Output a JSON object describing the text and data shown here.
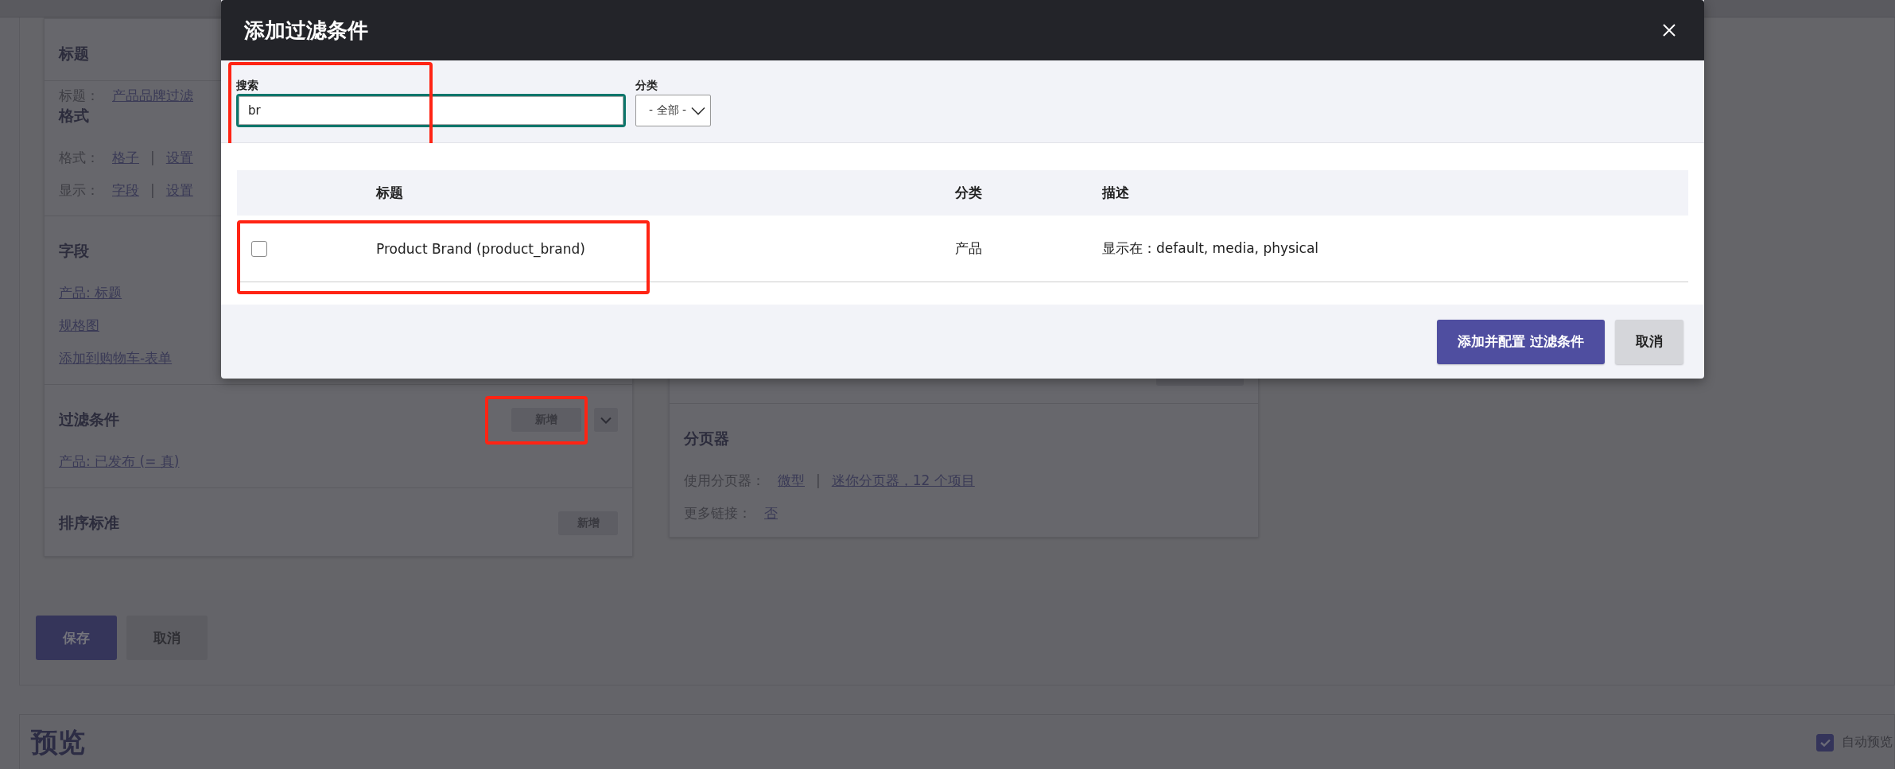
{
  "left_card": {
    "sections": [
      {
        "kind": "fields",
        "heading": "标题",
        "rows": [
          {
            "label": "标题：",
            "values": [
              "产品品牌过滤"
            ]
          }
        ]
      },
      {
        "kind": "fields",
        "heading": "格式",
        "rows": [
          {
            "label": "格式：",
            "values": [
              "格子",
              "设置"
            ],
            "separator": "|"
          },
          {
            "label": "显示：",
            "values": [
              "字段",
              "设置"
            ],
            "separator": "|"
          }
        ]
      },
      {
        "kind": "links",
        "heading": "字段",
        "links": [
          "产品: 标题",
          "规格图",
          "添加到购物车-表单"
        ]
      },
      {
        "kind": "links",
        "heading": "过滤条件",
        "add_button": {
          "label": "新增",
          "highlighted": true,
          "dropdown": true
        },
        "links": [
          "产品: 已发布 (= 真)"
        ]
      },
      {
        "kind": "links",
        "heading": "排序标准",
        "add_button": {
          "label": "新增",
          "highlighted": false,
          "dropdown": false
        }
      }
    ]
  },
  "middle_card": {
    "sections": [
      {
        "kind": "fields",
        "heading": "分页器",
        "rows": [
          {
            "label": "使用分页器：",
            "values": [
              "微型",
              "迷你分页器，12 个项目"
            ],
            "separator": "|"
          },
          {
            "label": "更多链接：",
            "values": [
              "否"
            ]
          }
        ]
      }
    ]
  },
  "form_actions": [
    {
      "label": "保存",
      "kind": "primary"
    },
    {
      "label": "取消",
      "kind": "secondary"
    }
  ],
  "preview": {
    "title": "预览",
    "auto_preview": {
      "label": "自动预览",
      "checked": true
    }
  },
  "modal": {
    "title": "添加过滤条件",
    "search": {
      "label": "搜索",
      "value": "br",
      "highlighted": true
    },
    "category": {
      "label": "分类",
      "value": "- 全部 -"
    },
    "table": {
      "columns": [
        "标题",
        "分类",
        "描述"
      ],
      "rows": [
        {
          "checked": false,
          "highlighted": true,
          "cells": [
            "Product Brand (product_brand)",
            "产品",
            "显示在：default, media, physical"
          ]
        }
      ]
    },
    "buttons": [
      {
        "label": "添加并配置 过滤条件",
        "kind": "primary"
      },
      {
        "label": "取消",
        "kind": "secondary"
      }
    ]
  }
}
